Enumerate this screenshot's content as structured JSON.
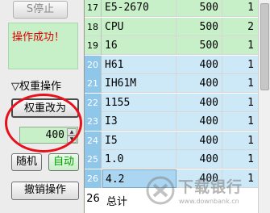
{
  "left_panel": {
    "stop_button": "S停止",
    "status_text": "操作成功！",
    "group_label": "▽权重操作",
    "weight_button": "权重改为",
    "weight_value": "400",
    "random_button": "随机",
    "auto_button": "自动",
    "undo_button": "撤销操作"
  },
  "table": {
    "rows": [
      {
        "index": "17",
        "name": "E5-2670",
        "weight": "500",
        "count": "1",
        "style": "green"
      },
      {
        "index": "18",
        "name": "CPU",
        "weight": "500",
        "count": "2",
        "style": "green"
      },
      {
        "index": "19",
        "name": "16",
        "weight": "500",
        "count": "1",
        "style": "green"
      },
      {
        "index": "20",
        "name": "H61",
        "weight": "400",
        "count": "1",
        "style": "blue"
      },
      {
        "index": "21",
        "name": "IH61M",
        "weight": "400",
        "count": "1",
        "style": "blue"
      },
      {
        "index": "22",
        "name": "1155",
        "weight": "400",
        "count": "1",
        "style": "blue"
      },
      {
        "index": "23",
        "name": "I3",
        "weight": "400",
        "count": "1",
        "style": "blue"
      },
      {
        "index": "24",
        "name": "I5",
        "weight": "400",
        "count": "1",
        "style": "blue"
      },
      {
        "index": "25",
        "name": "1.0",
        "weight": "400",
        "count": "1",
        "style": "blue"
      },
      {
        "index": "26",
        "name": "4.2",
        "weight": "400",
        "count": "1",
        "style": "blue sel"
      }
    ],
    "total_index": "26",
    "total_label": "总计"
  },
  "watermark": {
    "text": "下载银行",
    "url": "www.downbank.cn"
  }
}
